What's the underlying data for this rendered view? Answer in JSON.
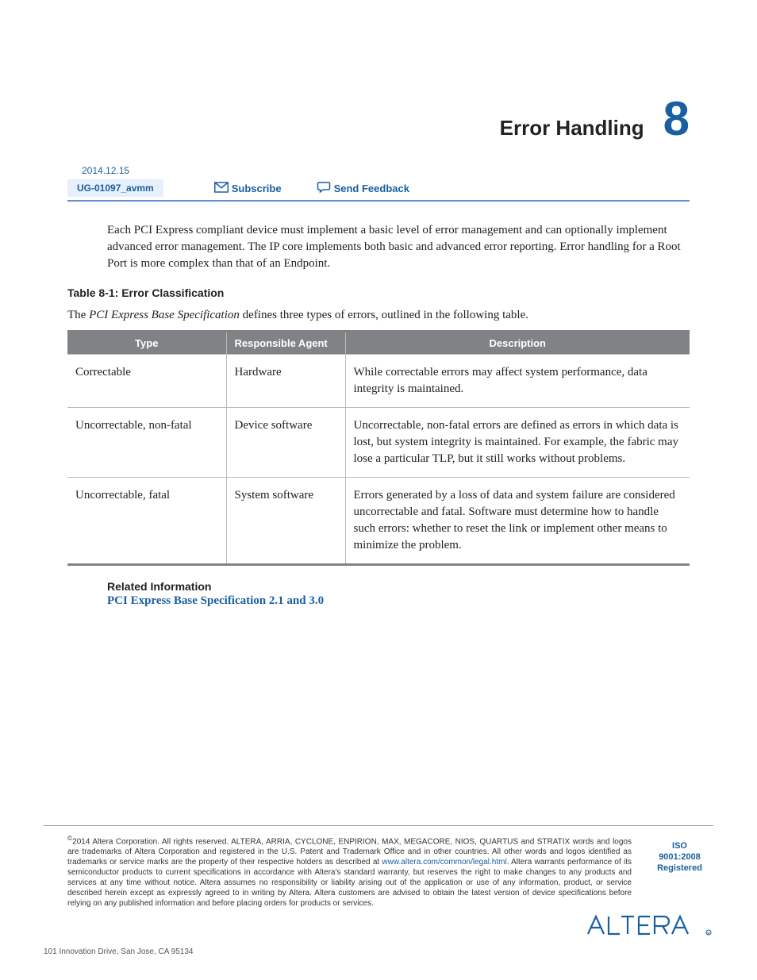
{
  "chapter": {
    "title": "Error Handling",
    "number": "8"
  },
  "meta": {
    "date": "2014.12.15",
    "doc_id": "UG-01097_avmm",
    "subscribe_label": "Subscribe",
    "feedback_label": "Send Feedback"
  },
  "intro": "Each PCI Express compliant device must implement a basic level of error management and can optionally implement advanced error management. The IP core implements both basic and advanced error reporting. Error handling for a Root Port is more complex than that of an Endpoint.",
  "table": {
    "caption": "Table 8-1: Error Classification",
    "intro_pre": "The ",
    "intro_em": "PCI Express Base Specification",
    "intro_post": " defines three types of errors, outlined in the following table.",
    "headers": [
      "Type",
      "Responsible Agent",
      "Description"
    ],
    "rows": [
      {
        "type": "Correctable",
        "agent": "Hardware",
        "desc": "While correctable errors may affect system performance, data integrity is maintained."
      },
      {
        "type": "Uncorrectable, non-fatal",
        "agent": "Device software",
        "desc": "Uncorrectable, non-fatal errors are defined as errors in which data is lost, but system integrity is maintained. For example, the fabric may lose a particular TLP, but it still works without problems."
      },
      {
        "type": "Uncorrectable, fatal",
        "agent": "System software",
        "desc": "Errors generated by a loss of data and system failure are considered uncorrectable and fatal. Software must determine how to handle such errors: whether to reset the link or implement other means to minimize the problem."
      }
    ]
  },
  "related": {
    "heading": "Related Information",
    "link": "PCI Express Base Specification 2.1 and 3.0"
  },
  "footer": {
    "copyright_symbol": "©",
    "legal_pre": "2014 Altera Corporation. All rights reserved. ALTERA, ARRIA, CYCLONE, ENPIRION, MAX, MEGACORE, NIOS, QUARTUS and STRATIX words and logos are trademarks of Altera Corporation and registered in the U.S. Patent and Trademark Office and in other countries. All other words and logos identified as trademarks or service marks are the property of their respective holders as described at ",
    "legal_link": "www.altera.com/common/legal.html",
    "legal_post": ". Altera warrants performance of its semiconductor products to current specifications in accordance with Altera's standard warranty, but reserves the right to make changes to any products and services at any time without notice. Altera assumes no responsibility or liability arising out of the application or use of any information, product, or service described herein except as expressly agreed to in writing by Altera. Altera customers are advised to obtain the latest version of device specifications before relying on any published information and before placing orders for products or services.",
    "iso_line1": "ISO",
    "iso_line2": "9001:2008",
    "iso_line3": "Registered",
    "address": "101 Innovation Drive, San Jose, CA 95134"
  }
}
